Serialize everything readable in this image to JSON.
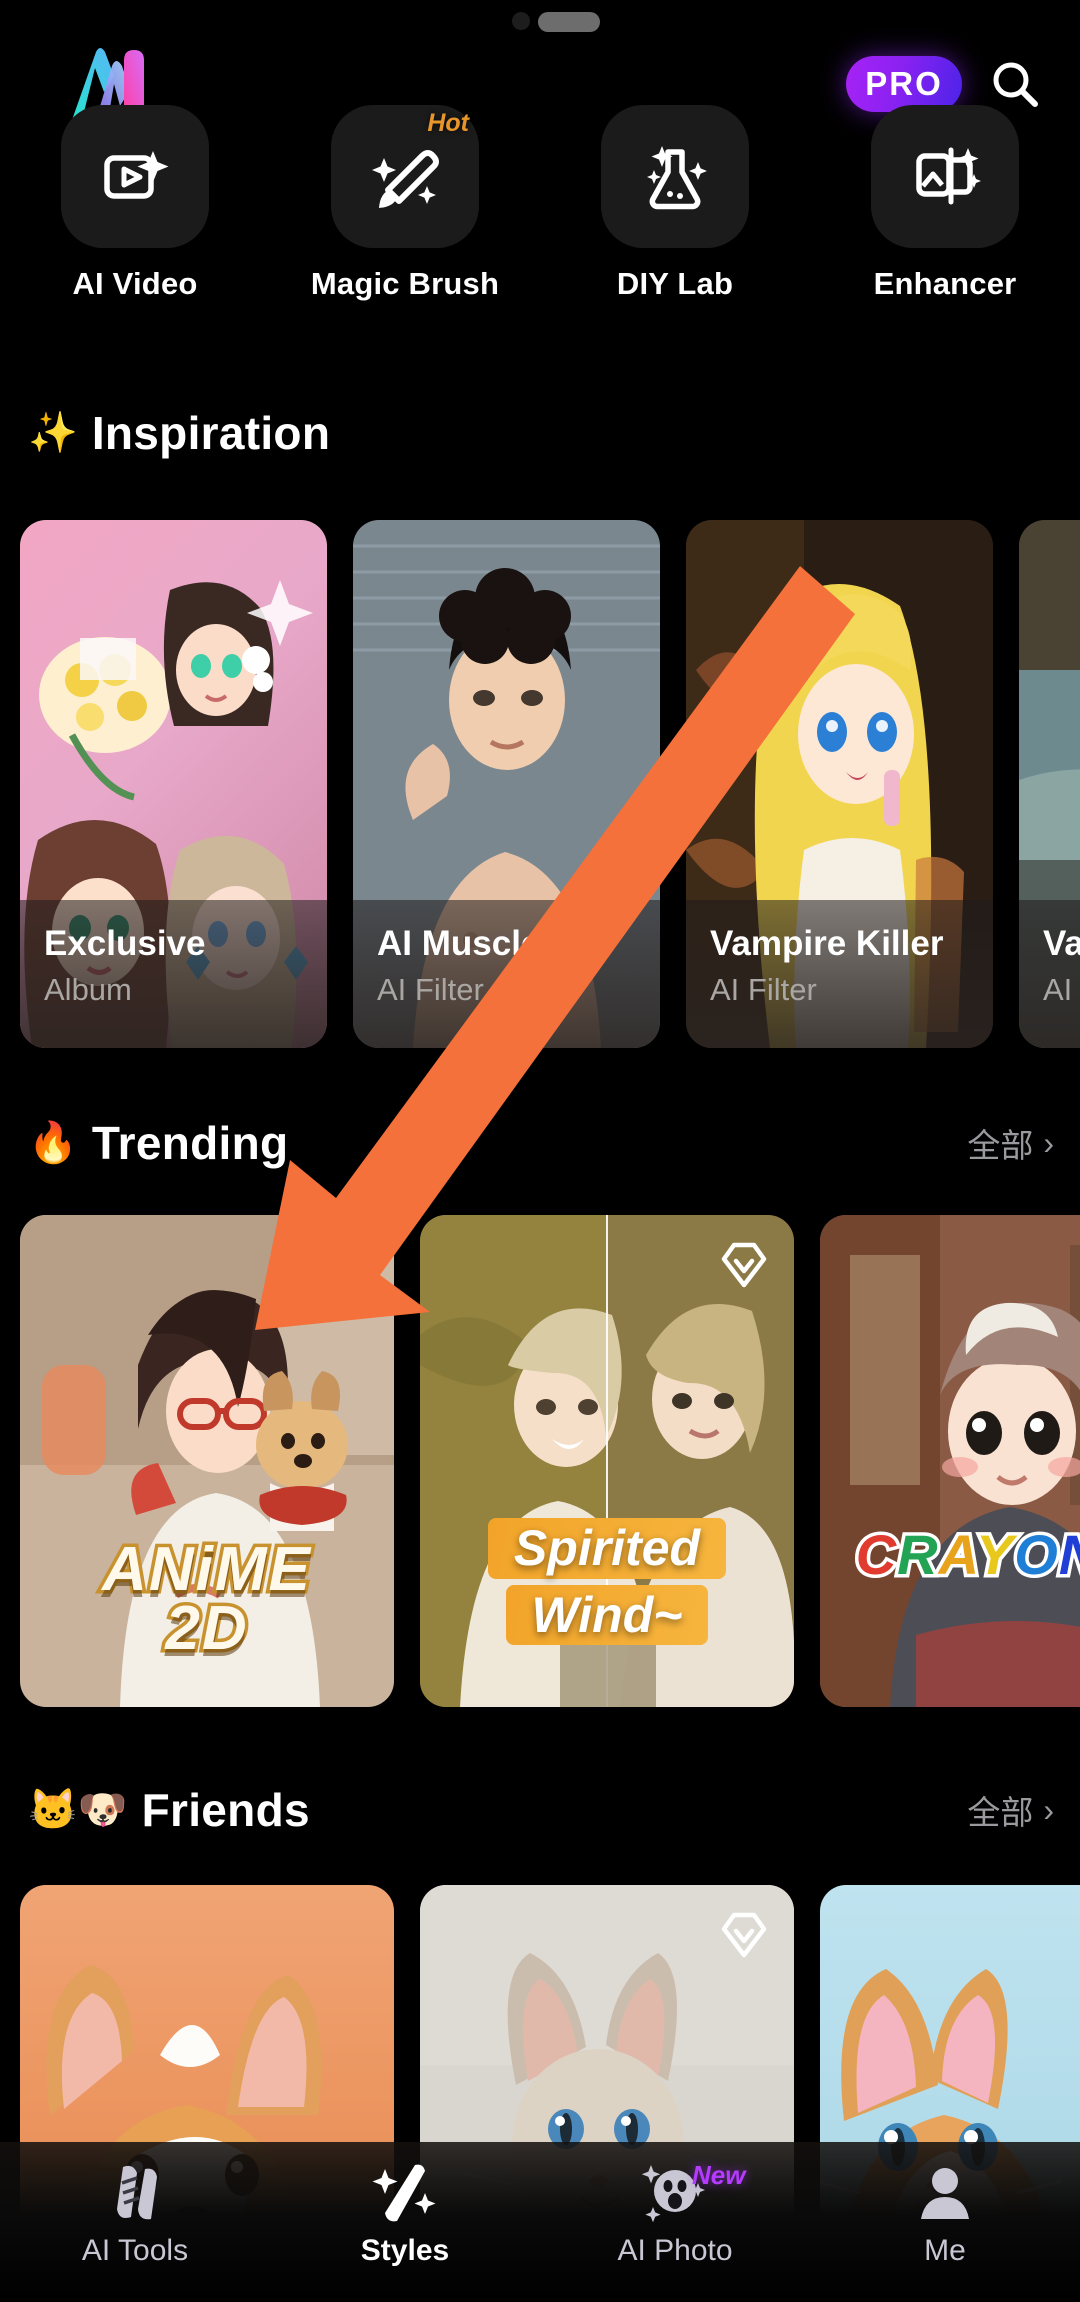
{
  "app": {
    "logo": "m-logo",
    "pro_label": "PRO",
    "search_icon": "search-icon"
  },
  "tools": [
    {
      "label": "AI Video",
      "icon": "ai-video-icon",
      "badge": null
    },
    {
      "label": "Magic Brush",
      "icon": "magic-brush-icon",
      "badge": "Hot"
    },
    {
      "label": "DIY Lab",
      "icon": "diy-lab-icon",
      "badge": null
    },
    {
      "label": "Enhancer",
      "icon": "enhancer-icon",
      "badge": null
    }
  ],
  "sections": {
    "inspiration": {
      "emoji": "✨",
      "title": "Inspiration",
      "cards": [
        {
          "title": "Exclusive",
          "subtitle": "Album"
        },
        {
          "title": "AI Muscle",
          "subtitle": "AI Filter"
        },
        {
          "title": "Vampire Killer",
          "subtitle": "AI Filter"
        },
        {
          "title": "Vac",
          "subtitle": "AI P"
        }
      ]
    },
    "trending": {
      "emoji": "🔥",
      "title": "Trending",
      "more_label": "全部",
      "cards": [
        {
          "overlay_line1": "ANiME",
          "overlay_line2": "2D",
          "badge": null
        },
        {
          "overlay_line1": "Spirited",
          "overlay_line2": "Wind~",
          "badge": "gem-icon"
        },
        {
          "overlay_line1": "CRAYON B",
          "overlay_line2": "",
          "badge": null
        }
      ]
    },
    "friends": {
      "emoji": "🐱🐶",
      "title": "Friends",
      "more_label": "全部",
      "cards": [
        {
          "subject": "corgi-dog",
          "badge": null
        },
        {
          "subject": "gray-cat",
          "badge": "gem-icon"
        },
        {
          "subject": "orange-kitten",
          "badge": null
        }
      ]
    }
  },
  "navbar": {
    "items": [
      {
        "label": "AI Tools",
        "icon": "ai-tools-icon",
        "active": false,
        "badge": null
      },
      {
        "label": "Styles",
        "icon": "styles-icon",
        "active": true,
        "badge": null
      },
      {
        "label": "AI Photo",
        "icon": "ai-photo-icon",
        "active": false,
        "badge": "New"
      },
      {
        "label": "Me",
        "icon": "profile-icon",
        "active": false,
        "badge": null
      }
    ]
  },
  "annotation": {
    "type": "arrow",
    "color": "#F4713B"
  }
}
